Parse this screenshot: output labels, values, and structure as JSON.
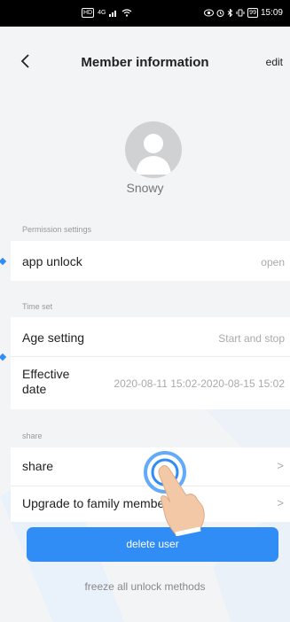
{
  "status_bar": {
    "hd": "HD",
    "signal": "4G",
    "time": "15:09",
    "battery": "99"
  },
  "nav": {
    "title": "Member information",
    "edit_label": "edit"
  },
  "member": {
    "name": "Snowy"
  },
  "sections": {
    "permission": {
      "label": "Permission settings",
      "app_unlock": {
        "title": "app unlock",
        "value": "open"
      }
    },
    "time_set": {
      "label": "Time set",
      "age_setting": {
        "title": "Age setting",
        "value": "Start and stop"
      },
      "effective_date": {
        "title_line1": "Effective",
        "title_line2": "date",
        "value": "2020-08-11 15:02-2020-08-15 15:02"
      }
    },
    "share": {
      "label": "share",
      "share_item": {
        "title": "share"
      },
      "upgrade_item": {
        "title": "Upgrade to family membe"
      }
    }
  },
  "actions": {
    "delete_label": "delete user",
    "freeze_label": "freeze all unlock methods"
  },
  "colors": {
    "accent": "#2f8df5",
    "background": "#f3f4f6",
    "statusbar": "#000000"
  }
}
